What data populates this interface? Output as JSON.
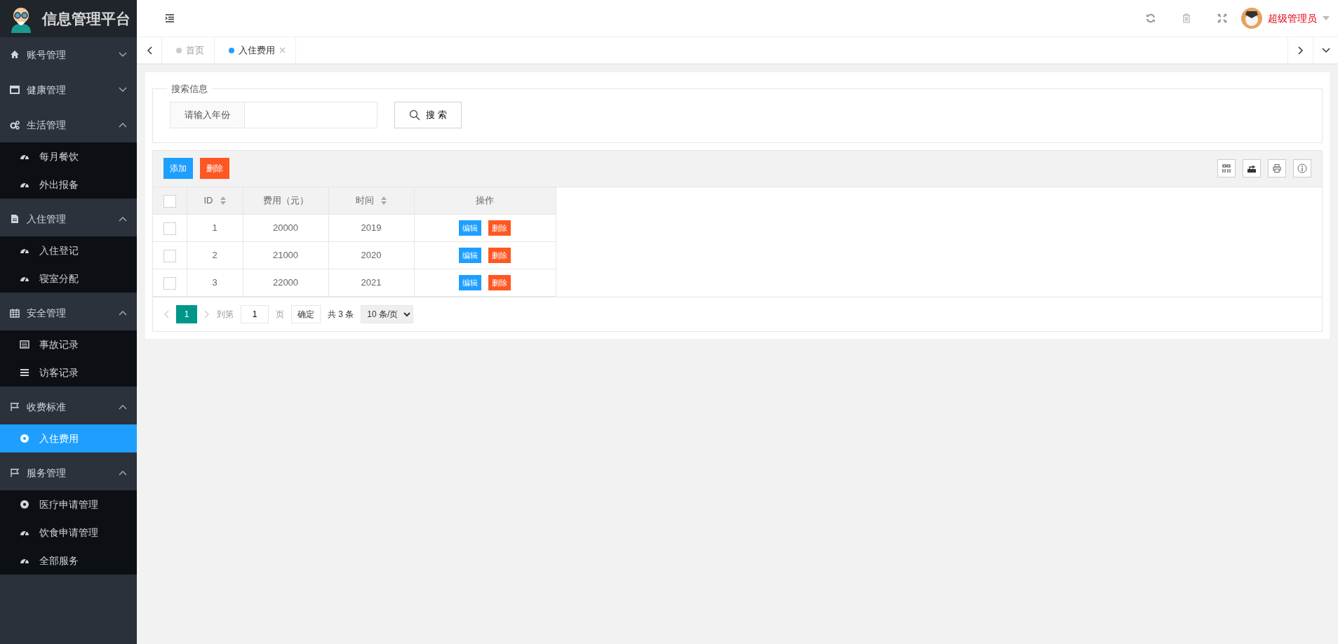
{
  "sidebar": {
    "title": "信息管理平台",
    "groups": [
      {
        "label": "账号管理",
        "expanded": false
      },
      {
        "label": "健康管理",
        "expanded": false
      },
      {
        "label": "生活管理",
        "expanded": true,
        "children": [
          {
            "label": "每月餐饮",
            "selected": false
          },
          {
            "label": "外出报备",
            "selected": false
          }
        ]
      },
      {
        "label": "入住管理",
        "expanded": true,
        "children": [
          {
            "label": "入住登记",
            "selected": false
          },
          {
            "label": "寝室分配",
            "selected": false
          }
        ]
      },
      {
        "label": "安全管理",
        "expanded": true,
        "children": [
          {
            "label": "事故记录",
            "selected": false
          },
          {
            "label": "访客记录",
            "selected": false
          }
        ]
      },
      {
        "label": "收费标准",
        "expanded": true,
        "children": [
          {
            "label": "入住费用",
            "selected": true
          }
        ]
      },
      {
        "label": "服务管理",
        "expanded": true,
        "children": [
          {
            "label": "医疗申请管理",
            "selected": false
          },
          {
            "label": "饮食申请管理",
            "selected": false
          },
          {
            "label": "全部服务",
            "selected": false
          }
        ]
      }
    ]
  },
  "header": {
    "user": "超级管理员"
  },
  "tabs": [
    {
      "label": "首页",
      "selected": false
    },
    {
      "label": "入住费用",
      "selected": true
    }
  ],
  "search": {
    "legend": "搜索信息",
    "label": "请输入年份",
    "button": "搜 索"
  },
  "toolbar": [
    {
      "label": "添加",
      "kind": "primary"
    },
    {
      "label": "删除",
      "kind": "danger"
    }
  ],
  "table": {
    "select_all": {
      "checked": false
    },
    "columns": [
      {
        "label": "ID",
        "sortable": true
      },
      {
        "label": "费用（元）",
        "sortable": false
      },
      {
        "label": "时间",
        "sortable": true
      },
      {
        "label": "操作",
        "sortable": false
      }
    ],
    "rows": [
      {
        "checked": false,
        "cells": [
          "1",
          "20000",
          "2019"
        ],
        "actions": [
          "编辑",
          "删除"
        ]
      },
      {
        "checked": false,
        "cells": [
          "2",
          "21000",
          "2020"
        ],
        "actions": [
          "编辑",
          "删除"
        ]
      },
      {
        "checked": false,
        "cells": [
          "3",
          "22000",
          "2021"
        ],
        "actions": [
          "编辑",
          "删除"
        ]
      }
    ]
  },
  "pagination": {
    "pages": [
      {
        "label": "1",
        "selected": true
      }
    ],
    "goto_label": "到第",
    "goto_value": "1",
    "page_unit": "页",
    "confirm": "确定",
    "total": "共 3 条",
    "page_size": "10 条/页"
  }
}
